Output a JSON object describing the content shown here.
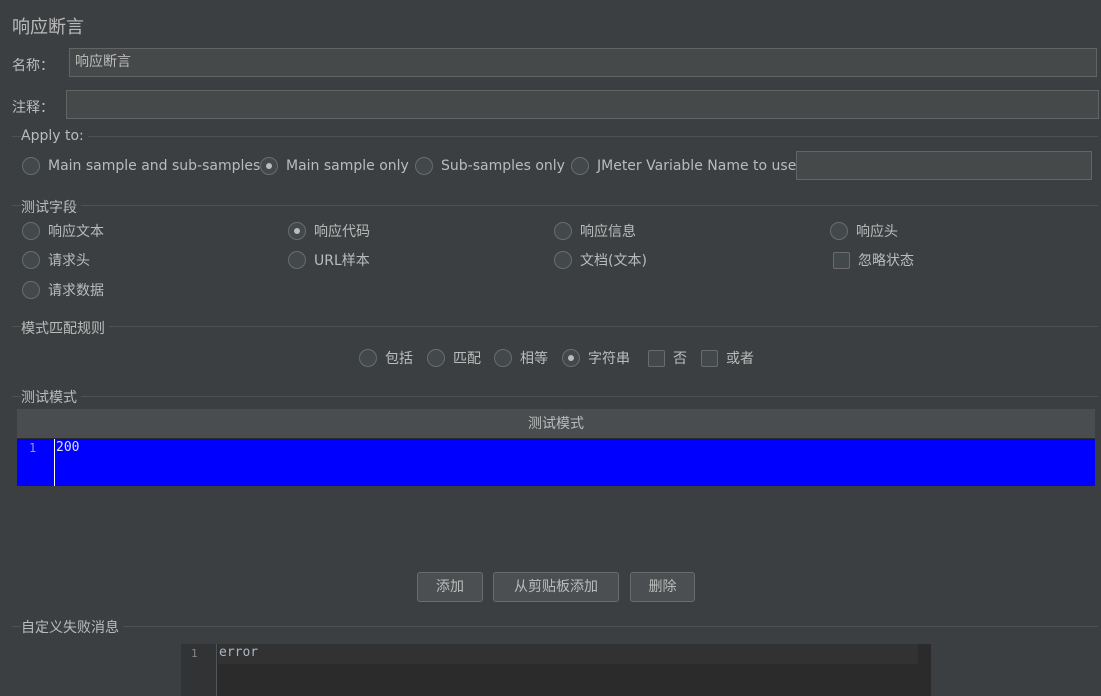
{
  "title": "响应断言",
  "name_field": {
    "label": "名称：",
    "value": "响应断言"
  },
  "comment_field": {
    "label": "注释：",
    "value": ""
  },
  "apply_to": {
    "title": "Apply to:",
    "options": [
      {
        "label": "Main sample and sub-samples",
        "selected": false
      },
      {
        "label": "Main sample only",
        "selected": true
      },
      {
        "label": "Sub-samples only",
        "selected": false
      },
      {
        "label": "JMeter Variable Name to use",
        "selected": false
      }
    ],
    "variable_value": ""
  },
  "test_field": {
    "title": "测试字段",
    "options": [
      {
        "label": "响应文本",
        "selected": false,
        "type": "radio"
      },
      {
        "label": "响应代码",
        "selected": true,
        "type": "radio"
      },
      {
        "label": "响应信息",
        "selected": false,
        "type": "radio"
      },
      {
        "label": "响应头",
        "selected": false,
        "type": "radio"
      },
      {
        "label": "请求头",
        "selected": false,
        "type": "radio"
      },
      {
        "label": "URL样本",
        "selected": false,
        "type": "radio"
      },
      {
        "label": "文档(文本)",
        "selected": false,
        "type": "radio"
      },
      {
        "label": "忽略状态",
        "selected": false,
        "type": "checkbox"
      },
      {
        "label": "请求数据",
        "selected": false,
        "type": "radio"
      }
    ]
  },
  "pattern_rules": {
    "title": "模式匹配规则",
    "options": [
      {
        "label": "包括",
        "selected": false,
        "type": "radio"
      },
      {
        "label": "匹配",
        "selected": false,
        "type": "radio"
      },
      {
        "label": "相等",
        "selected": false,
        "type": "radio"
      },
      {
        "label": "字符串",
        "selected": true,
        "type": "radio"
      },
      {
        "label": "否",
        "selected": false,
        "type": "checkbox"
      },
      {
        "label": "或者",
        "selected": false,
        "type": "checkbox"
      }
    ]
  },
  "test_patterns": {
    "title": "测试模式",
    "column_header": "测试模式",
    "rows": [
      {
        "line": "1",
        "value": "200"
      }
    ]
  },
  "buttons": {
    "add": "添加",
    "add_clipboard": "从剪贴板添加",
    "delete": "删除"
  },
  "failure_message": {
    "title": "自定义失败消息",
    "lines": [
      {
        "line": "1",
        "text": "error"
      }
    ]
  }
}
